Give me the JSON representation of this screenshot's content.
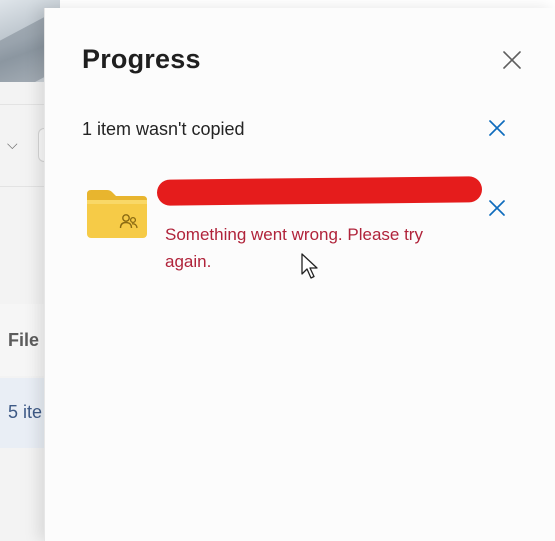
{
  "background": {
    "column_header": "File",
    "row_text": "5 ite"
  },
  "panel": {
    "title": "Progress",
    "summary": "1 item wasn't copied",
    "item": {
      "error": "Something went wrong. Please try again."
    }
  },
  "icons": {
    "close": "close-icon",
    "dismiss": "close-icon",
    "folder": "shared-folder-icon",
    "cursor": "mouse-pointer-icon"
  },
  "colors": {
    "accent": "#0f6cbd",
    "error": "#b0233a",
    "folder": "#f5c842",
    "redaction": "#e51c1c"
  }
}
